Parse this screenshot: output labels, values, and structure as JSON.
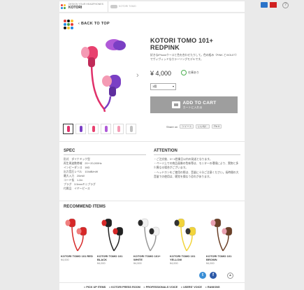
{
  "header": {
    "brand_tag": "DESIGN YOUR HEADPHONES",
    "brand_name": "KOTORI",
    "second_tab": "KOTORI TOMO",
    "help": "?",
    "colors": {
      "cart": "#2a73c9",
      "flag": "#d02020"
    }
  },
  "nav": {
    "back": "‹ BACK TO TOP"
  },
  "product": {
    "title": "KOTORI TOMO 101+ REDPINK",
    "description": "好きなiPhoneケースと色を合わせたりして。色の組み（PINK とVIOLET）でヴィヴィッドなカラーリングモデルです。",
    "price": "¥ 4,000",
    "stock": "在庫あり",
    "qty": "1個",
    "add_to_cart": "ADD TO CART",
    "add_to_cart_sub": "カートに入れる",
    "share_label": "Share on",
    "share_buttons": [
      "ツイート",
      "いいね！",
      "Pin it"
    ],
    "colors": {
      "cord": "#e0306a",
      "bud_left": "#e8406e",
      "bud_right": "#7a3fc4",
      "tip_left": "#f49ab4",
      "tip_right": "#b05ad8"
    }
  },
  "thumbs": [
    {
      "color": "#e0306a"
    },
    {
      "color": "#7a3fc4"
    },
    {
      "color": "#e8406e"
    },
    {
      "color": "#b05ad8"
    },
    {
      "color": "#f49ab4"
    },
    {
      "color": "#c0c0c0"
    }
  ],
  "spec": {
    "heading": "SPEC",
    "items": [
      "形式　ダイナミック型",
      "再生周波数帯域　20～20,000Hz",
      "インピーダンス　16Ω",
      "出力音圧レベル　104dB/mW",
      "最大入力　20mW",
      "コード長　1.2m",
      "プラグ　3.5mmミニプラグ",
      "付属品　イヤーピース"
    ]
  },
  "attention": {
    "heading": "ATTENTION",
    "items": [
      "・ご注文後、3〜4営業日以内の発送となります。",
      "・ページ上での商品画像の色味等は、モニターの環境により、実物と多少異なる場合がございます。",
      "・ヘッドホンをご使用の際は、音量に十分ご注意ください。長時間の大音量での使用は、聴覚を損なう恐れがあります。"
    ]
  },
  "recommend": {
    "heading": "RECOMMEND ITEMS",
    "items": [
      {
        "name": "KOTORI TOMO 101 RED",
        "price": "¥4,000",
        "color": "#d62828",
        "tip": "#f08080"
      },
      {
        "name": "KOTORI TOMO 101 BLACK",
        "price": "¥4,000",
        "color": "#222222",
        "tip": "#d62828"
      },
      {
        "name": "KOTORI TOMO 101+ WHITE",
        "price": "¥4,000",
        "color": "#f0f0f0",
        "tip": "#2a2a2a"
      },
      {
        "name": "KOTORI TOMO 101 YELLOW",
        "price": "¥4,000",
        "color": "#f2d43a",
        "tip": "#333333"
      },
      {
        "name": "KOTORI TOMO 101 BROWN",
        "price": "¥4,000",
        "color": "#6b4028",
        "tip": "#e8a0b0"
      }
    ]
  },
  "footer": {
    "links": [
      "PICK UP ITEMS",
      "KOTORI PRESS ROOM",
      "PROFESSIONALS VOICE",
      "USERS' VOICE",
      "RANKING"
    ],
    "twitter": "t",
    "facebook": "f",
    "totop": "▲"
  }
}
